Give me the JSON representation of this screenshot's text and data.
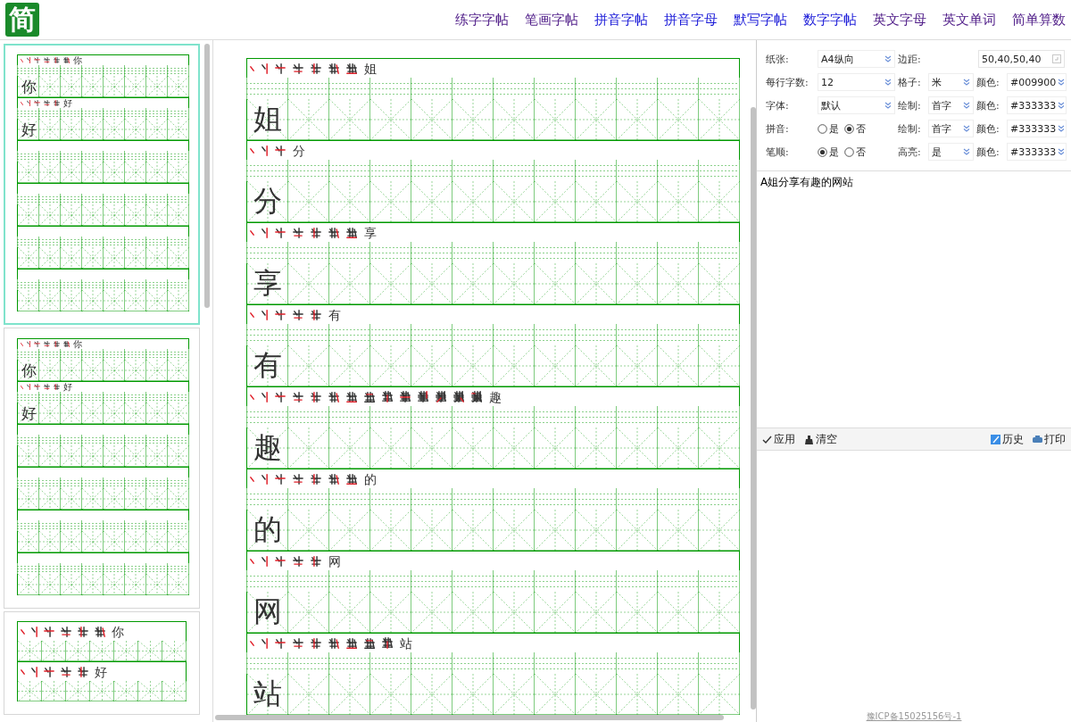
{
  "header": {
    "logo": "简",
    "nav": [
      {
        "label": "练字字帖",
        "visited": true
      },
      {
        "label": "笔画字帖",
        "visited": true
      },
      {
        "label": "拼音字帖",
        "visited": false
      },
      {
        "label": "拼音字母",
        "visited": false
      },
      {
        "label": "默写字帖",
        "visited": false
      },
      {
        "label": "数字字帖",
        "visited": false
      },
      {
        "label": "英文字母",
        "visited": true
      },
      {
        "label": "英文单词",
        "visited": true
      },
      {
        "label": "简单算数",
        "visited": true
      }
    ]
  },
  "thumbnails": [
    {
      "selected": true,
      "kind": "compact",
      "characters": [
        {
          "character": "你",
          "steps": [
            {
              "kind": "partial"
            },
            {
              "kind": "partial"
            },
            {
              "kind": "partial"
            },
            {
              "kind": "partial"
            },
            {
              "kind": "partial"
            },
            {
              "kind": "partial"
            },
            {
              "kind": "complete",
              "text": "你"
            }
          ]
        },
        {
          "character": "好",
          "steps": [
            {
              "kind": "partial"
            },
            {
              "kind": "partial"
            },
            {
              "kind": "partial"
            },
            {
              "kind": "partial"
            },
            {
              "kind": "partial"
            },
            {
              "kind": "complete",
              "text": "好"
            }
          ]
        }
      ]
    },
    {
      "selected": false,
      "kind": "compact",
      "characters": [
        {
          "character": "你",
          "steps": [
            {
              "kind": "partial"
            },
            {
              "kind": "partial"
            },
            {
              "kind": "partial"
            },
            {
              "kind": "partial"
            },
            {
              "kind": "partial"
            },
            {
              "kind": "partial"
            },
            {
              "kind": "complete",
              "text": "你"
            }
          ]
        },
        {
          "character": "好",
          "steps": [
            {
              "kind": "partial"
            },
            {
              "kind": "partial"
            },
            {
              "kind": "partial"
            },
            {
              "kind": "partial"
            },
            {
              "kind": "partial"
            },
            {
              "kind": "complete",
              "text": "好"
            }
          ]
        }
      ]
    },
    {
      "selected": false,
      "kind": "large",
      "characters": [
        {
          "steps": [
            {
              "kind": "partial"
            },
            {
              "kind": "partial"
            },
            {
              "kind": "partial"
            },
            {
              "kind": "partial"
            },
            {
              "kind": "partial"
            },
            {
              "kind": "partial"
            },
            {
              "kind": "complete",
              "text": "你"
            }
          ]
        },
        {
          "steps": [
            {
              "kind": "partial"
            },
            {
              "kind": "partial"
            },
            {
              "kind": "partial"
            },
            {
              "kind": "partial"
            },
            {
              "kind": "partial"
            },
            {
              "kind": "complete",
              "text": "好"
            }
          ]
        }
      ]
    }
  ],
  "sheet": {
    "characters": [
      {
        "character": "姐",
        "steps": [
          {
            "kind": "partial"
          },
          {
            "kind": "partial"
          },
          {
            "kind": "partial"
          },
          {
            "kind": "partial"
          },
          {
            "kind": "partial"
          },
          {
            "kind": "partial"
          },
          {
            "kind": "partial"
          },
          {
            "kind": "complete",
            "text": "姐"
          }
        ]
      },
      {
        "character": "分",
        "steps": [
          {
            "kind": "partial"
          },
          {
            "kind": "partial"
          },
          {
            "kind": "partial"
          },
          {
            "kind": "complete",
            "text": "分"
          }
        ]
      },
      {
        "character": "享",
        "steps": [
          {
            "kind": "partial"
          },
          {
            "kind": "partial"
          },
          {
            "kind": "partial"
          },
          {
            "kind": "partial"
          },
          {
            "kind": "partial"
          },
          {
            "kind": "partial"
          },
          {
            "kind": "partial"
          },
          {
            "kind": "complete",
            "text": "享"
          }
        ]
      },
      {
        "character": "有",
        "steps": [
          {
            "kind": "partial"
          },
          {
            "kind": "partial"
          },
          {
            "kind": "partial"
          },
          {
            "kind": "partial"
          },
          {
            "kind": "partial"
          },
          {
            "kind": "complete",
            "text": "有"
          }
        ]
      },
      {
        "character": "趣",
        "steps": [
          {
            "kind": "partial"
          },
          {
            "kind": "partial"
          },
          {
            "kind": "partial"
          },
          {
            "kind": "partial"
          },
          {
            "kind": "partial"
          },
          {
            "kind": "partial"
          },
          {
            "kind": "partial"
          },
          {
            "kind": "partial"
          },
          {
            "kind": "partial"
          },
          {
            "kind": "partial"
          },
          {
            "kind": "partial"
          },
          {
            "kind": "partial"
          },
          {
            "kind": "partial"
          },
          {
            "kind": "partial"
          },
          {
            "kind": "complete",
            "text": "趣"
          }
        ]
      },
      {
        "character": "的",
        "steps": [
          {
            "kind": "partial"
          },
          {
            "kind": "partial"
          },
          {
            "kind": "partial"
          },
          {
            "kind": "partial"
          },
          {
            "kind": "partial"
          },
          {
            "kind": "partial"
          },
          {
            "kind": "partial"
          },
          {
            "kind": "complete",
            "text": "的"
          }
        ]
      },
      {
        "character": "网",
        "steps": [
          {
            "kind": "partial"
          },
          {
            "kind": "partial"
          },
          {
            "kind": "partial"
          },
          {
            "kind": "partial"
          },
          {
            "kind": "partial"
          },
          {
            "kind": "complete",
            "text": "网"
          }
        ]
      },
      {
        "character": "站",
        "steps": [
          {
            "kind": "partial"
          },
          {
            "kind": "partial"
          },
          {
            "kind": "partial"
          },
          {
            "kind": "partial"
          },
          {
            "kind": "partial"
          },
          {
            "kind": "partial"
          },
          {
            "kind": "partial"
          },
          {
            "kind": "partial"
          },
          {
            "kind": "partial"
          },
          {
            "kind": "complete",
            "text": "站"
          }
        ]
      }
    ]
  },
  "settings": [
    [
      {
        "kind": "select",
        "label": "纸张:",
        "value": "A4纵向"
      },
      {
        "kind": "input",
        "label": "边距:",
        "value": "50,40,50,40"
      }
    ],
    [
      {
        "kind": "select",
        "label": "每行字数:",
        "value": "12"
      },
      {
        "kind": "select",
        "label": "格子:",
        "value": "米"
      },
      {
        "kind": "select",
        "label": "颜色:",
        "value": "#009900"
      }
    ],
    [
      {
        "kind": "select",
        "label": "字体:",
        "value": "默认"
      },
      {
        "kind": "select",
        "label": "绘制:",
        "value": "首字"
      },
      {
        "kind": "select",
        "label": "颜色:",
        "value": "#333333"
      }
    ],
    [
      {
        "kind": "radio",
        "label": "拼音:",
        "options": [
          {
            "label": "是",
            "selected": false
          },
          {
            "label": "否",
            "selected": true
          }
        ]
      },
      {
        "kind": "select",
        "label": "绘制:",
        "value": "首字"
      },
      {
        "kind": "select",
        "label": "颜色:",
        "value": "#333333"
      }
    ],
    [
      {
        "kind": "radio",
        "label": "笔顺:",
        "options": [
          {
            "label": "是",
            "selected": true
          },
          {
            "label": "否",
            "selected": false
          }
        ]
      },
      {
        "kind": "select",
        "label": "高亮:",
        "value": "是"
      },
      {
        "kind": "select",
        "label": "颜色:",
        "value": "#333333"
      }
    ]
  ],
  "text_input": {
    "value": "A姐分享有趣的网站"
  },
  "toolbar": [
    {
      "kind": "apply",
      "label": "应用"
    },
    {
      "kind": "clear",
      "label": "清空"
    },
    {
      "kind": "history",
      "label": "历史"
    },
    {
      "kind": "print",
      "label": "打印"
    }
  ],
  "footer": "豫ICP备15025156号-1"
}
